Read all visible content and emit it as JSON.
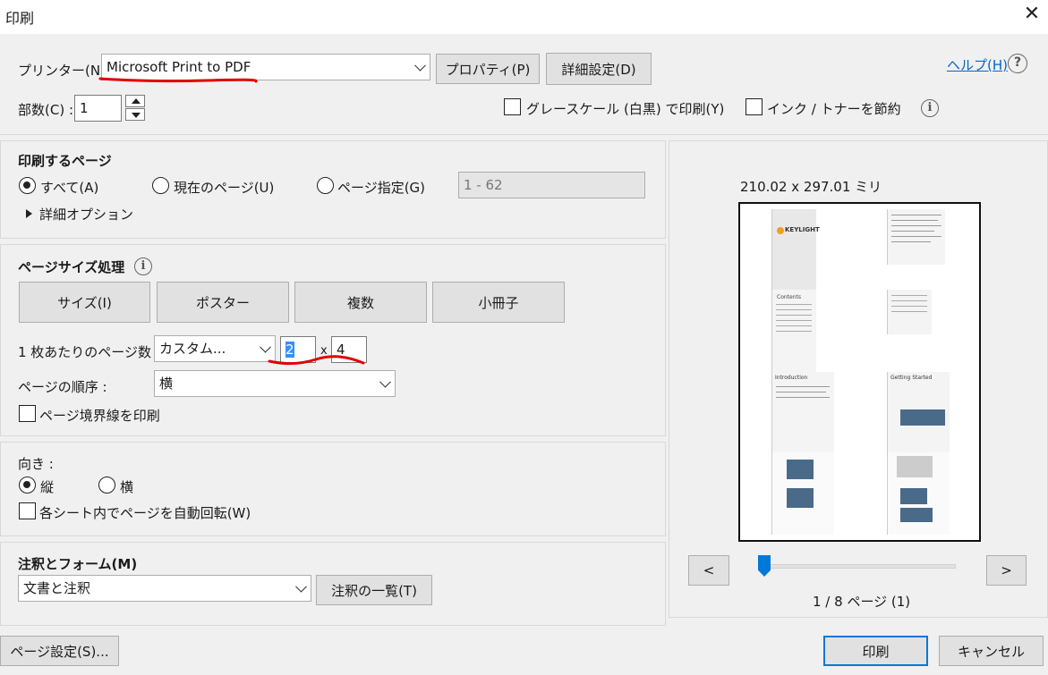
{
  "window": {
    "title": "印刷",
    "close_glyph": "✕"
  },
  "top": {
    "printer_label": "プリンター(N) :",
    "printer_value": "Microsoft Print to PDF",
    "properties_button": "プロパティ(P)",
    "advanced_button": "詳細設定(D)",
    "help_link": "ヘルプ(H)",
    "copies_label": "部数(C) :",
    "copies_value": "1",
    "grayscale_label": "グレースケール (白黒) で印刷(Y)",
    "save_ink_label": "インク / トナーを節約"
  },
  "pages_to_print": {
    "heading": "印刷するページ",
    "all_label": "すべて(A)",
    "current_label": "現在のページ(U)",
    "range_label": "ページ指定(G)",
    "range_value": "1 - 62",
    "more_options": "詳細オプション",
    "selected": "all"
  },
  "page_sizing": {
    "heading": "ページサイズ処理",
    "tabs": [
      "サイズ(I)",
      "ポスター",
      "複数",
      "小冊子"
    ],
    "per_sheet_label": "1 枚あたりのページ数 :",
    "per_sheet_value": "カスタム...",
    "cols": "2",
    "x_label": "x",
    "rows": "4",
    "order_label": "ページの順序 :",
    "order_value": "横",
    "border_label": "ページ境界線を印刷"
  },
  "orientation": {
    "heading": "向き :",
    "portrait_label": "縦",
    "landscape_label": "横",
    "selected": "portrait",
    "auto_rotate_label": "各シート内でページを自動回転(W)"
  },
  "comments_forms": {
    "heading": "注釈とフォーム(M)",
    "value": "文書と注釈",
    "summary_button": "注釈の一覧(T)"
  },
  "preview": {
    "size_text": "210.02 x 297.01 ミリ",
    "prev_button": "<",
    "next_button": ">",
    "page_status": "1 / 8 ページ (1)",
    "thumb_logo": "KEYLIGHT",
    "thumb_contents": "Contents",
    "thumb_intro": "Introduction",
    "thumb_getting_started": "Getting Started"
  },
  "footer": {
    "page_setup_button": "ページ設定(S)...",
    "print_button": "印刷",
    "cancel_button": "キャンセル"
  },
  "colors": {
    "accent": "#0078d7",
    "annotation_red": "#e00000",
    "link": "#0066cc"
  },
  "icons": [
    "close-icon",
    "help-icon",
    "info-icon",
    "chevron-down-icon",
    "spin-up-icon",
    "spin-down-icon",
    "expand-triangle-icon"
  ]
}
